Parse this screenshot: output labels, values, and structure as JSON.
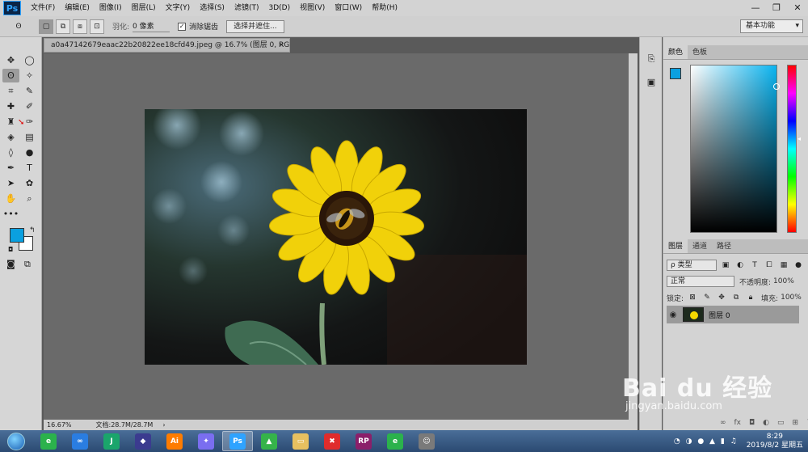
{
  "app": {
    "logo": "Ps",
    "menu": [
      "文件(F)",
      "编辑(E)",
      "图像(I)",
      "图层(L)",
      "文字(Y)",
      "选择(S)",
      "滤镜(T)",
      "3D(D)",
      "视图(V)",
      "窗口(W)",
      "帮助(H)"
    ],
    "window_controls": [
      "—",
      "❐",
      "✕"
    ]
  },
  "options": {
    "feather_label": "羽化:",
    "feather_value": "0 像素",
    "antialias_label": "消除锯齿",
    "antialias_checked": true,
    "select_mask_button": "选择并遮住...",
    "workspace": "基本功能"
  },
  "document": {
    "tab_title": "a0a47142679eaac22b20822ee18cfd49.jpeg @ 16.7% (图层 0, RGB/8) *",
    "close_glyph": "×",
    "zoom": "16.67%",
    "doc_size": "文档:28.7M/28.7M"
  },
  "tools": [
    {
      "name": "move-tool",
      "glyph": "✥"
    },
    {
      "name": "marquee-ellipse-tool",
      "glyph": "◯"
    },
    {
      "name": "lasso-tool",
      "glyph": "ʘ",
      "active": true
    },
    {
      "name": "magic-wand-tool",
      "glyph": "✧"
    },
    {
      "name": "crop-tool",
      "glyph": "⌗"
    },
    {
      "name": "eyedropper-tool",
      "glyph": "✎"
    },
    {
      "name": "healing-brush-tool",
      "glyph": "✚"
    },
    {
      "name": "brush-tool",
      "glyph": "✐"
    },
    {
      "name": "clone-stamp-tool",
      "glyph": "♜"
    },
    {
      "name": "history-brush-tool",
      "glyph": "✑"
    },
    {
      "name": "eraser-tool",
      "glyph": "◈"
    },
    {
      "name": "gradient-tool",
      "glyph": "▤"
    },
    {
      "name": "blur-tool",
      "glyph": "◊"
    },
    {
      "name": "dodge-tool",
      "glyph": "●"
    },
    {
      "name": "pen-tool",
      "glyph": "✒"
    },
    {
      "name": "type-tool",
      "glyph": "T"
    },
    {
      "name": "path-selection-tool",
      "glyph": "➤"
    },
    {
      "name": "custom-shape-tool",
      "glyph": "✿"
    },
    {
      "name": "hand-tool",
      "glyph": "✋"
    },
    {
      "name": "zoom-tool",
      "glyph": "⌕"
    },
    {
      "name": "more-tools",
      "glyph": "•••"
    },
    {
      "name": "spacer",
      "glyph": ""
    }
  ],
  "colors": {
    "foreground": "#0aa0e0",
    "background": "#ffffff"
  },
  "color_panel": {
    "tabs": [
      "颜色",
      "色板"
    ]
  },
  "layers_panel": {
    "tabs": [
      "图层",
      "通道",
      "路径"
    ],
    "filter_kind": "ρ 类型",
    "blend_mode": "正常",
    "opacity_label": "不透明度:",
    "opacity_value": "100%",
    "lock_label": "锁定:",
    "fill_label": "填充:",
    "fill_value": "100%",
    "layer_name": "图层 0"
  },
  "taskbar": {
    "apps": [
      {
        "name": "browser-360",
        "label": "e",
        "color": "#2bb24c"
      },
      {
        "name": "baidu-netdisk",
        "label": "∞",
        "color": "#2a7de1"
      },
      {
        "name": "app-j",
        "label": "J",
        "color": "#1aa56b"
      },
      {
        "name": "app-vs",
        "label": "◆",
        "color": "#3b3b8f"
      },
      {
        "name": "illustrator",
        "label": "Ai",
        "color": "#ff7c00"
      },
      {
        "name": "app-wing",
        "label": "✦",
        "color": "#7a6ef0"
      },
      {
        "name": "photoshop",
        "label": "Ps",
        "color": "#2fa3ff",
        "active": true
      },
      {
        "name": "app-green",
        "label": "▲",
        "color": "#35b34a"
      },
      {
        "name": "explorer",
        "label": "▭",
        "color": "#e8c060"
      },
      {
        "name": "xmind",
        "label": "✖",
        "color": "#e02c2c"
      },
      {
        "name": "axure-rp",
        "label": "RP",
        "color": "#8b1f6a"
      },
      {
        "name": "browser-360-2",
        "label": "e",
        "color": "#2bb24c"
      },
      {
        "name": "user-avatar",
        "label": "☺",
        "color": "#7a7a7a"
      }
    ],
    "time": "8:29",
    "date": "2019/8/2 星期五"
  },
  "watermark": {
    "logo": "Bai du 经验",
    "url": "jingyan.baidu.com"
  }
}
